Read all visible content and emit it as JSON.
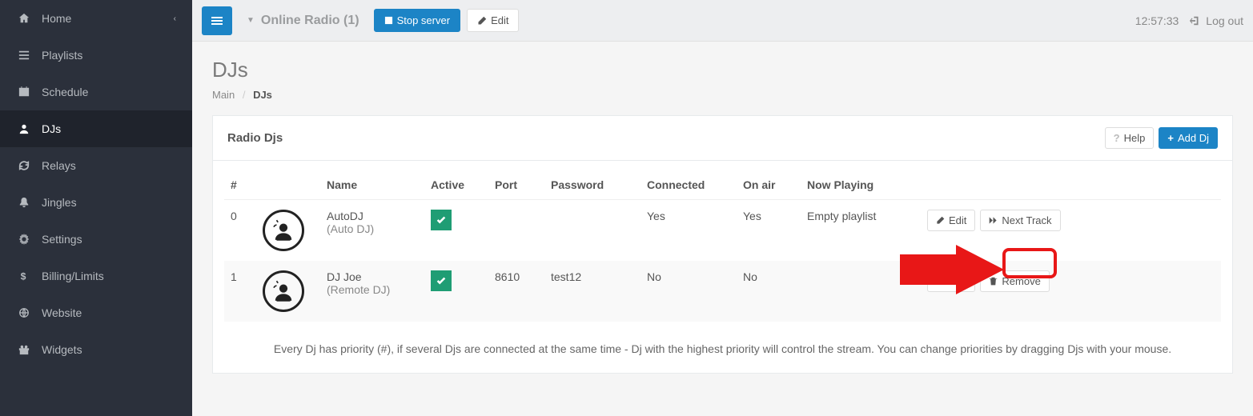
{
  "sidebar": {
    "items": [
      {
        "label": "Home"
      },
      {
        "label": "Playlists"
      },
      {
        "label": "Schedule"
      },
      {
        "label": "DJs"
      },
      {
        "label": "Relays"
      },
      {
        "label": "Jingles"
      },
      {
        "label": "Settings"
      },
      {
        "label": "Billing/Limits"
      },
      {
        "label": "Website"
      },
      {
        "label": "Widgets"
      }
    ]
  },
  "topbar": {
    "server_name": "Online Radio (1)",
    "stop_label": "Stop server",
    "edit_label": "Edit",
    "time": "12:57:33",
    "logout_label": "Log out"
  },
  "page": {
    "title": "DJs",
    "breadcrumb_main": "Main",
    "breadcrumb_current": "DJs"
  },
  "panel": {
    "title": "Radio Djs",
    "help_label": "Help",
    "add_label": "Add Dj",
    "footer_note": "Every Dj has priority (#), if several Djs are connected at the same time - Dj with the highest priority will control the stream. You can change priorities by dragging Djs with your mouse."
  },
  "table": {
    "headers": {
      "num": "#",
      "name": "Name",
      "active": "Active",
      "port": "Port",
      "password": "Password",
      "connected": "Connected",
      "onair": "On air",
      "nowplaying": "Now Playing"
    },
    "rows": [
      {
        "num": "0",
        "name": "AutoDJ",
        "subname": "(Auto DJ)",
        "active": true,
        "port": "",
        "password": "",
        "connected": "Yes",
        "onair": "Yes",
        "nowplaying": "Empty playlist",
        "edit_label": "Edit",
        "next_label": "Next Track"
      },
      {
        "num": "1",
        "name": "DJ Joe",
        "subname": "(Remote DJ)",
        "active": true,
        "port": "8610",
        "password": "test12",
        "connected": "No",
        "onair": "No",
        "nowplaying": "",
        "edit_label": "Edit",
        "remove_label": "Remove"
      }
    ]
  }
}
